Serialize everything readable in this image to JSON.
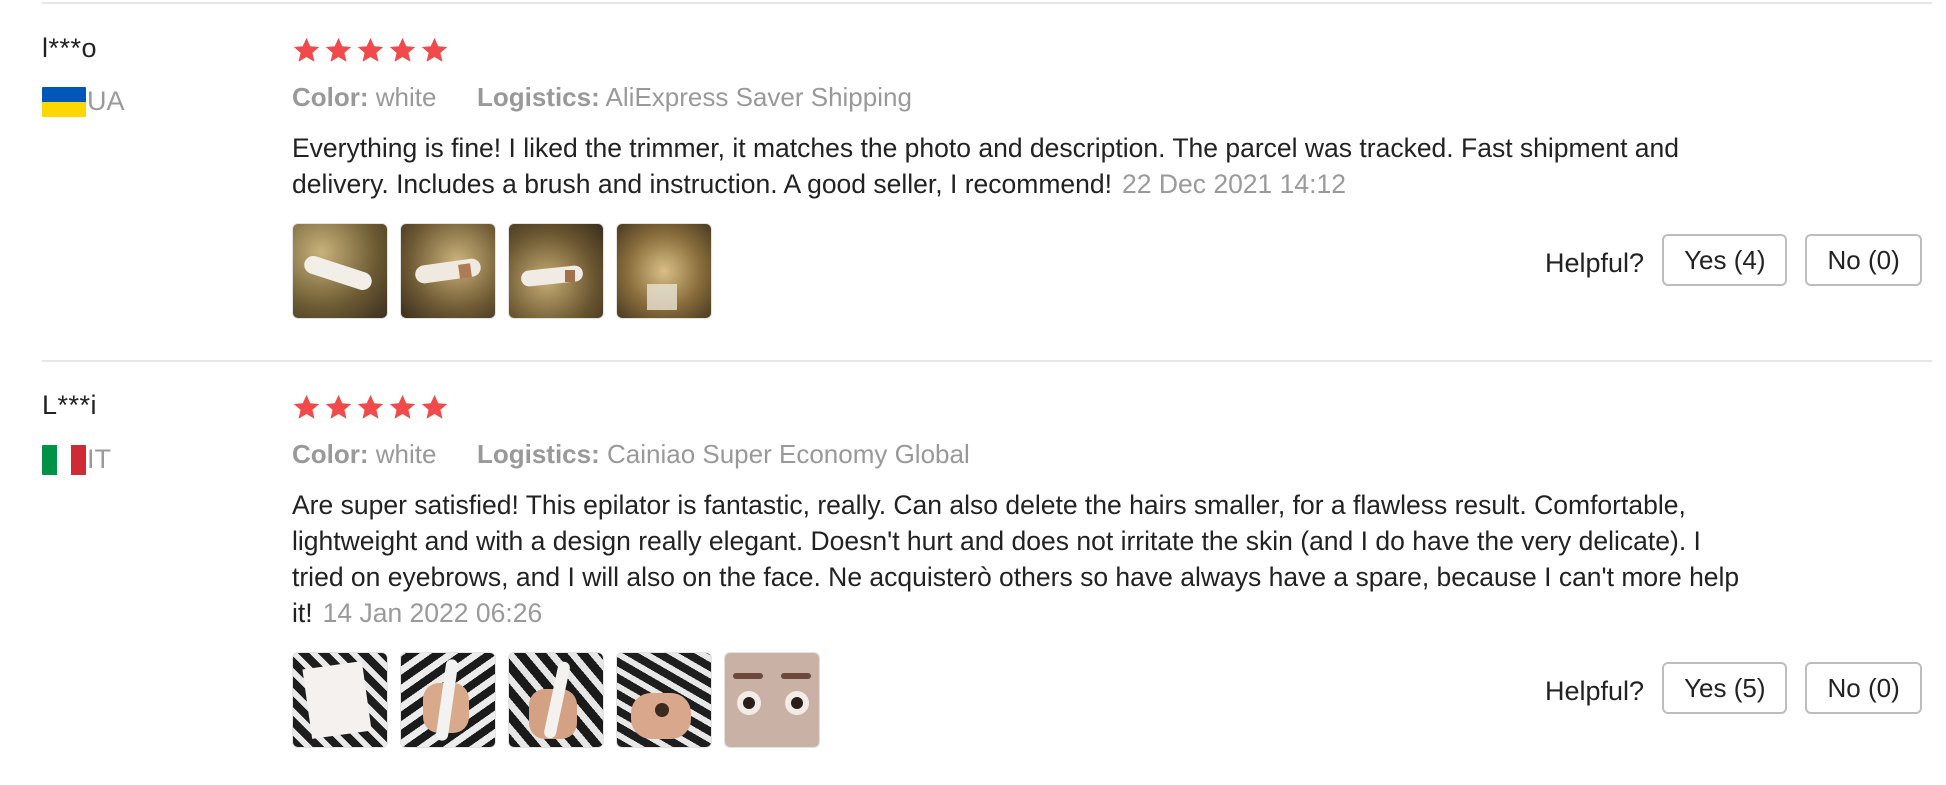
{
  "colors": {
    "star": "#f04a4a",
    "divider": "#e6e6e6",
    "muted_text": "#999999",
    "ua_blue": "#0057b7",
    "ua_yellow": "#ffd700",
    "it_green": "#009246",
    "it_white": "#ffffff",
    "it_red": "#ce2b37"
  },
  "reviews": [
    {
      "user": "l***o",
      "country_code": "UA",
      "flag_icon": "ukraine-flag-icon",
      "rating": 5,
      "color_label": "Color:",
      "color_value": "white",
      "logistics_label": "Logistics:",
      "logistics_value": "AliExpress Saver Shipping",
      "text": "Everything is fine! I liked the trimmer, it matches the photo and description. The parcel was tracked. Fast shipment and delivery. Includes a brush and instruction. A good seller, I recommend!",
      "date": "22 Dec 2021 14:12",
      "photo_count": 4,
      "helpful_label": "Helpful?",
      "yes_label": "Yes (4)",
      "no_label": "No (0)"
    },
    {
      "user": "L***i",
      "country_code": "IT",
      "flag_icon": "italy-flag-icon",
      "rating": 5,
      "color_label": "Color:",
      "color_value": "white",
      "logistics_label": "Logistics:",
      "logistics_value": "Cainiao Super Economy Global",
      "text": "Are super satisfied! This epilator is fantastic, really. Can also delete the hairs smaller, for a flawless result. Comfortable, lightweight and with a design really elegant. Doesn't hurt and does not irritate the skin (and I do have the very delicate). I tried on eyebrows, and I will also on the face. Ne acquisterò others so have always have a spare, because I can't more help it!",
      "date": "14 Jan 2022 06:26",
      "photo_count": 5,
      "helpful_label": "Helpful?",
      "yes_label": "Yes (5)",
      "no_label": "No (0)"
    }
  ]
}
